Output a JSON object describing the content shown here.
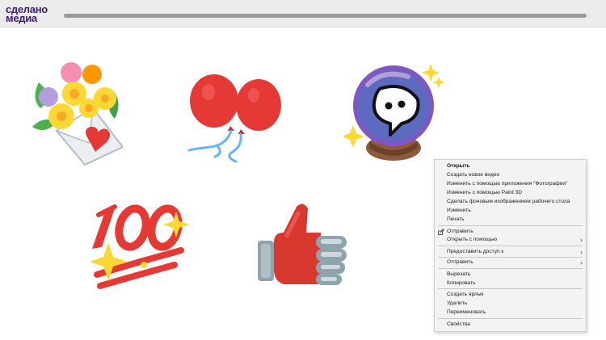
{
  "header": {
    "logo_line1": "сделано",
    "logo_line2": "медиа"
  },
  "stickers": [
    {
      "name": "flowers-envelope",
      "icon": "flowers-envelope-icon"
    },
    {
      "name": "red-balloons",
      "icon": "balloons-icon"
    },
    {
      "name": "crystal-ball",
      "icon": "crystal-ball-chat-icon"
    },
    {
      "name": "hundred-points",
      "icon": "hundred-icon"
    },
    {
      "name": "thumbs-up",
      "icon": "thumbs-up-icon"
    }
  ],
  "context_menu": {
    "items": [
      {
        "label": "Открыть",
        "bold": true
      },
      {
        "label": "Создать новое видео"
      },
      {
        "label": "Изменить с помощью приложения \"Фотографии\""
      },
      {
        "label": "Изменить с помощью Paint 3D"
      },
      {
        "label": "Сделать фоновым изображением рабочего стола"
      },
      {
        "label": "Изменить"
      },
      {
        "label": "Печать"
      },
      {
        "label": "Отправить",
        "icon": "share-icon"
      },
      {
        "label": "Открыть с помощью",
        "submenu": true
      },
      {
        "label": "Предоставить доступ к",
        "submenu": true
      },
      {
        "label": "Отправить",
        "submenu": true
      },
      {
        "label": "Вырезать"
      },
      {
        "label": "Копировать"
      },
      {
        "label": "Создать ярлык"
      },
      {
        "label": "Удалить"
      },
      {
        "label": "Переименовать"
      },
      {
        "label": "Свойства"
      }
    ]
  },
  "colors": {
    "accent_logo": "#3b1d6e",
    "menu_bg": "#f3f3f3",
    "balloon_red": "#e53935",
    "thumb_red": "#d8382e"
  }
}
